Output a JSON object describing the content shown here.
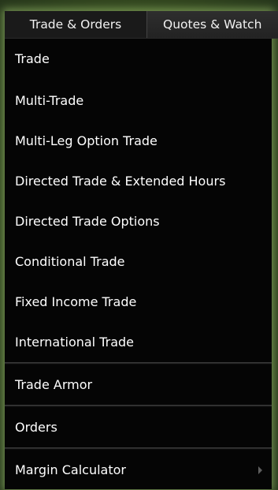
{
  "tabs": [
    {
      "label": "Trade & Orders",
      "active": true
    },
    {
      "label": "Quotes & Watch",
      "active": false
    }
  ],
  "menu": {
    "group1": [
      {
        "label": "Trade"
      },
      {
        "label": "Multi-Trade"
      },
      {
        "label": "Multi-Leg Option Trade"
      },
      {
        "label": "Directed Trade & Extended Hours"
      },
      {
        "label": "Directed Trade Options"
      },
      {
        "label": "Conditional Trade"
      },
      {
        "label": "Fixed Income Trade"
      },
      {
        "label": "International Trade"
      }
    ],
    "trade_armor": "Trade Armor",
    "orders": "Orders",
    "margin_calculator": "Margin Calculator",
    "submenu_icon": "chevron-right-icon"
  },
  "colors": {
    "menu_background": "#050505",
    "text": "#ffffff",
    "glow": "#aad278",
    "page_background": "#33471f"
  }
}
